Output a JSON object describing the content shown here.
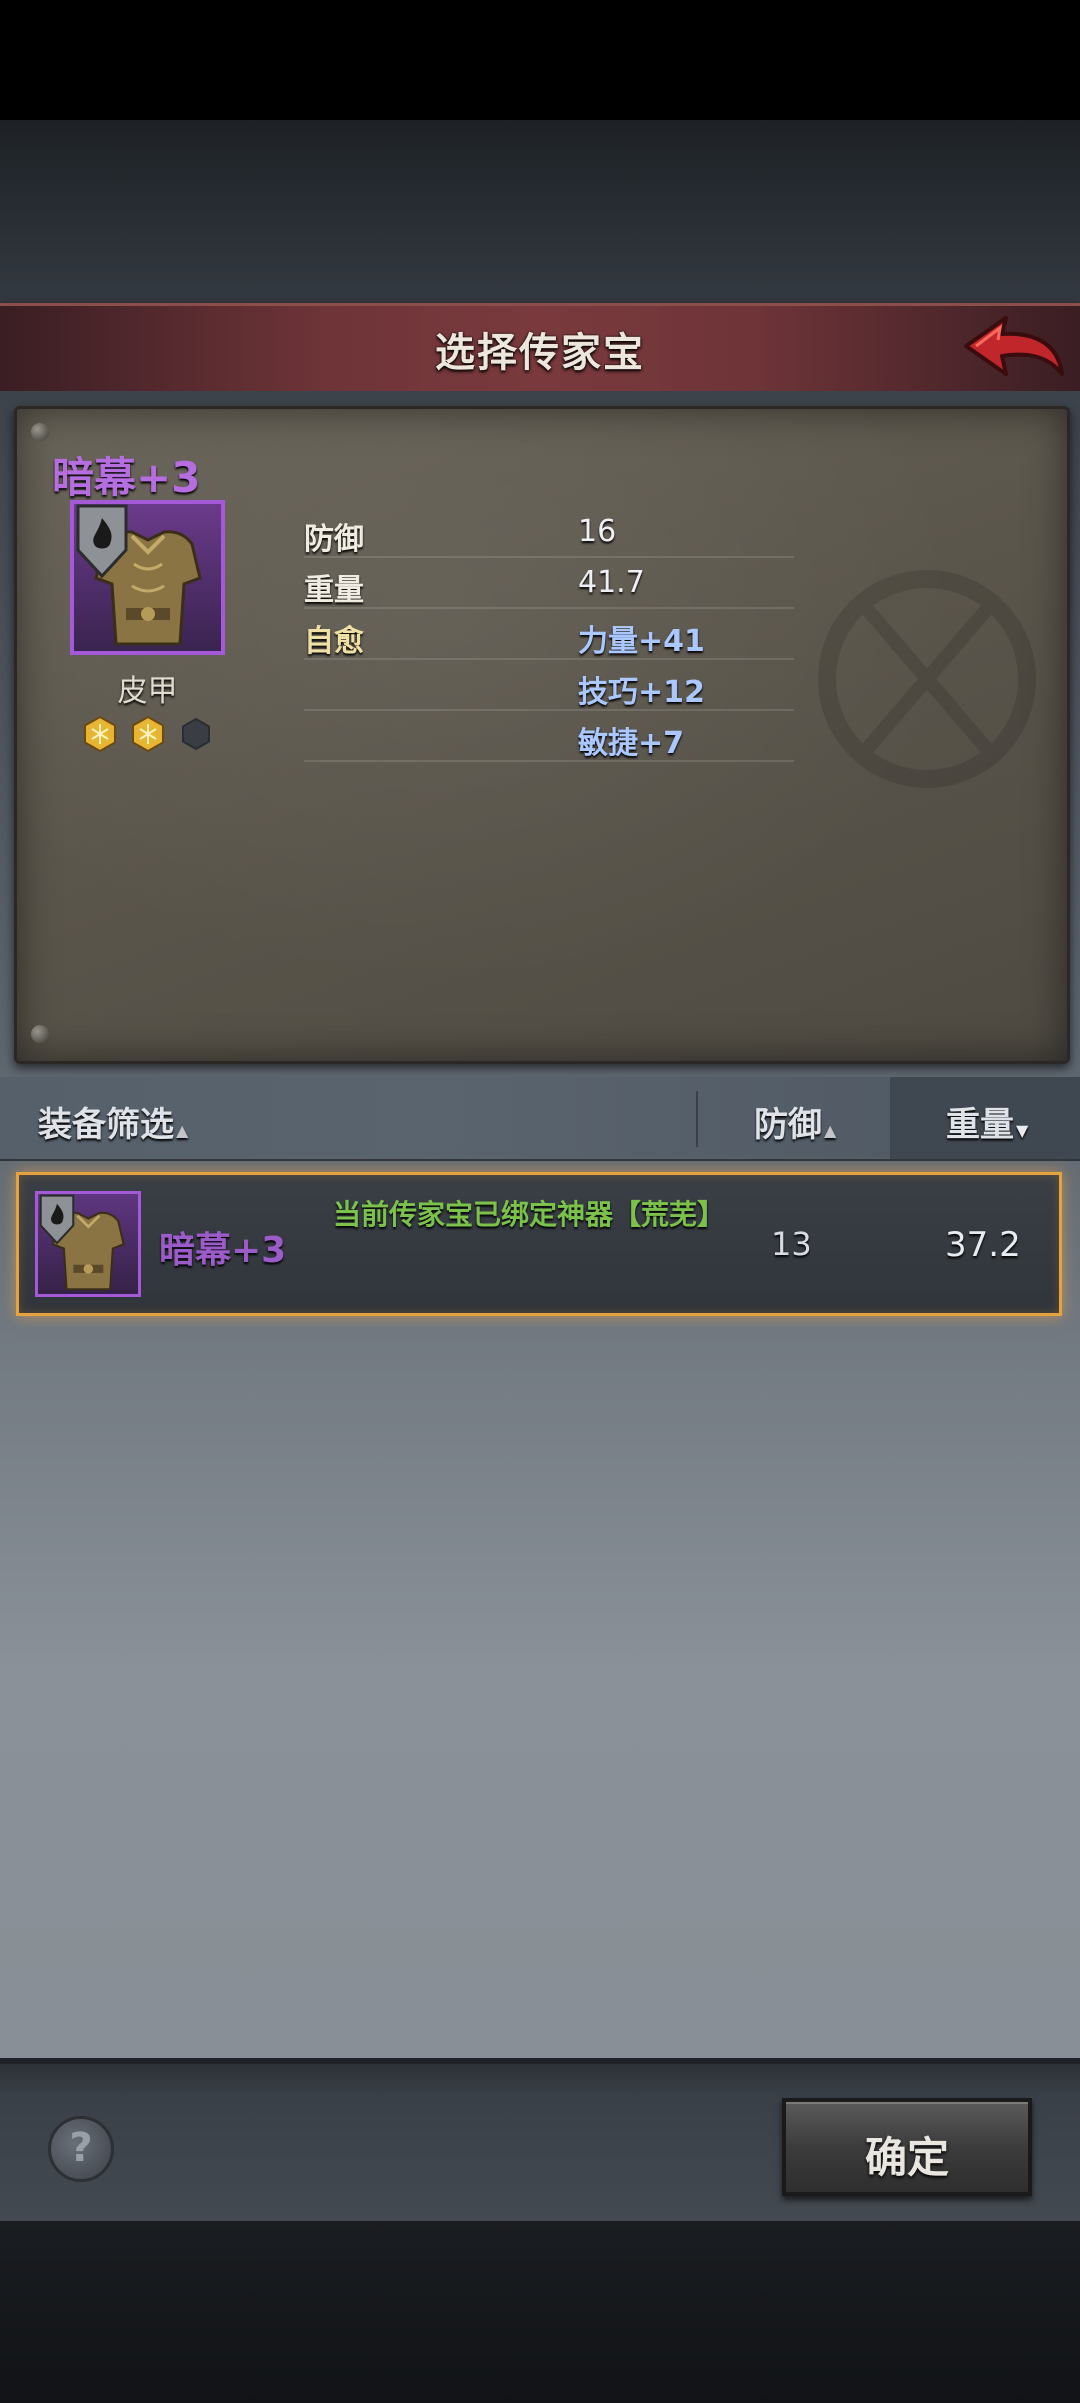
{
  "header": {
    "title": "选择传家宝"
  },
  "item": {
    "name": "暗幕+3",
    "type": "皮甲",
    "gems_filled": 2,
    "gems_total": 3
  },
  "stats": [
    {
      "label": "防御",
      "value": "16"
    },
    {
      "label": "重量",
      "value": "41.7"
    },
    {
      "label": "自愈",
      "value": "力量+41"
    },
    {
      "label": "",
      "value": "技巧+12"
    },
    {
      "label": "",
      "value": "敏捷+7"
    }
  ],
  "filter": {
    "equip_filter": "装备筛选",
    "defense": "防御",
    "weight": "重量"
  },
  "list": [
    {
      "name": "暗幕+3",
      "bound_note": "当前传家宝已绑定神器【荒芜】",
      "defense": "13",
      "weight": "37.2"
    }
  ],
  "footer": {
    "confirm": "确定",
    "help": "?"
  },
  "colors": {
    "rarity_purple": "#a45ad8",
    "selection_orange": "#e6a23c",
    "bound_green": "#7bc24b"
  }
}
